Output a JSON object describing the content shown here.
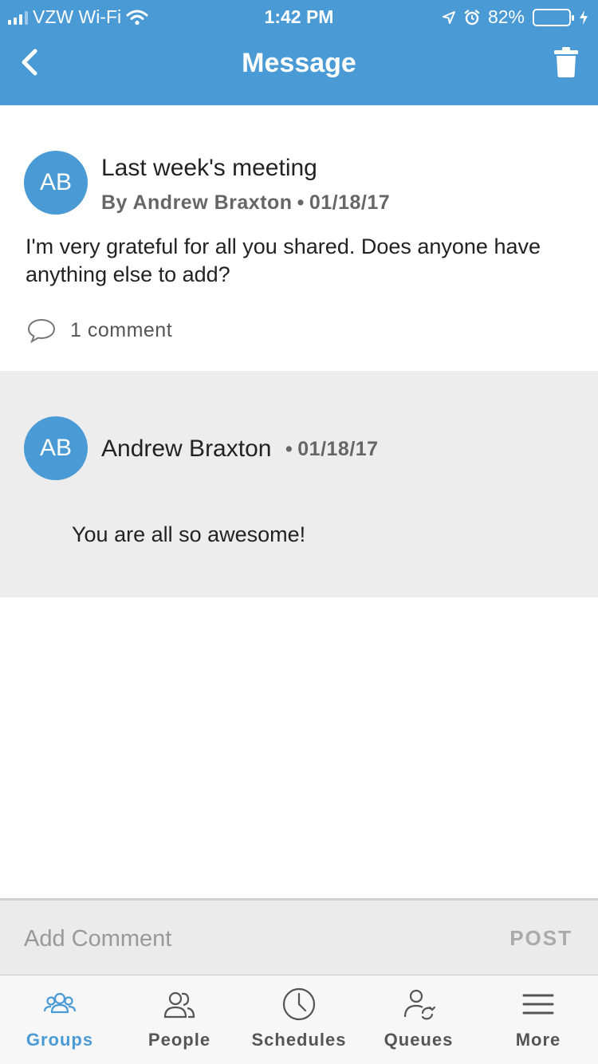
{
  "status_bar": {
    "carrier": "VZW Wi-Fi",
    "time": "1:42 PM",
    "battery_percent": "82%",
    "battery_level": 0.82,
    "battery_color": "#6fdd4a"
  },
  "nav": {
    "title": "Message",
    "back_icon": "chevron-left-icon",
    "trash_icon": "trash-icon"
  },
  "post": {
    "avatar_initials": "AB",
    "subject": "Last week's meeting",
    "by_author": "By Andrew Braxton",
    "separator": "•",
    "date": "01/18/17",
    "body": "I'm very grateful for all you shared. Does anyone have anything else to add?",
    "comment_count": "1 comment"
  },
  "comment": {
    "avatar_initials": "AB",
    "author": "Andrew Braxton",
    "separator": "•",
    "date": "01/18/17",
    "text": "You are all so awesome!"
  },
  "add_comment": {
    "placeholder": "Add Comment",
    "post_label": "POST"
  },
  "tabs": [
    {
      "label": "Groups",
      "icon": "groups-icon",
      "active": true
    },
    {
      "label": "People",
      "icon": "people-icon",
      "active": false
    },
    {
      "label": "Schedules",
      "icon": "clock-icon",
      "active": false
    },
    {
      "label": "Queues",
      "icon": "queues-icon",
      "active": false
    },
    {
      "label": "More",
      "icon": "menu-icon",
      "active": false
    }
  ],
  "colors": {
    "accent": "#4a9ad6",
    "comment_bg": "#ededed"
  }
}
